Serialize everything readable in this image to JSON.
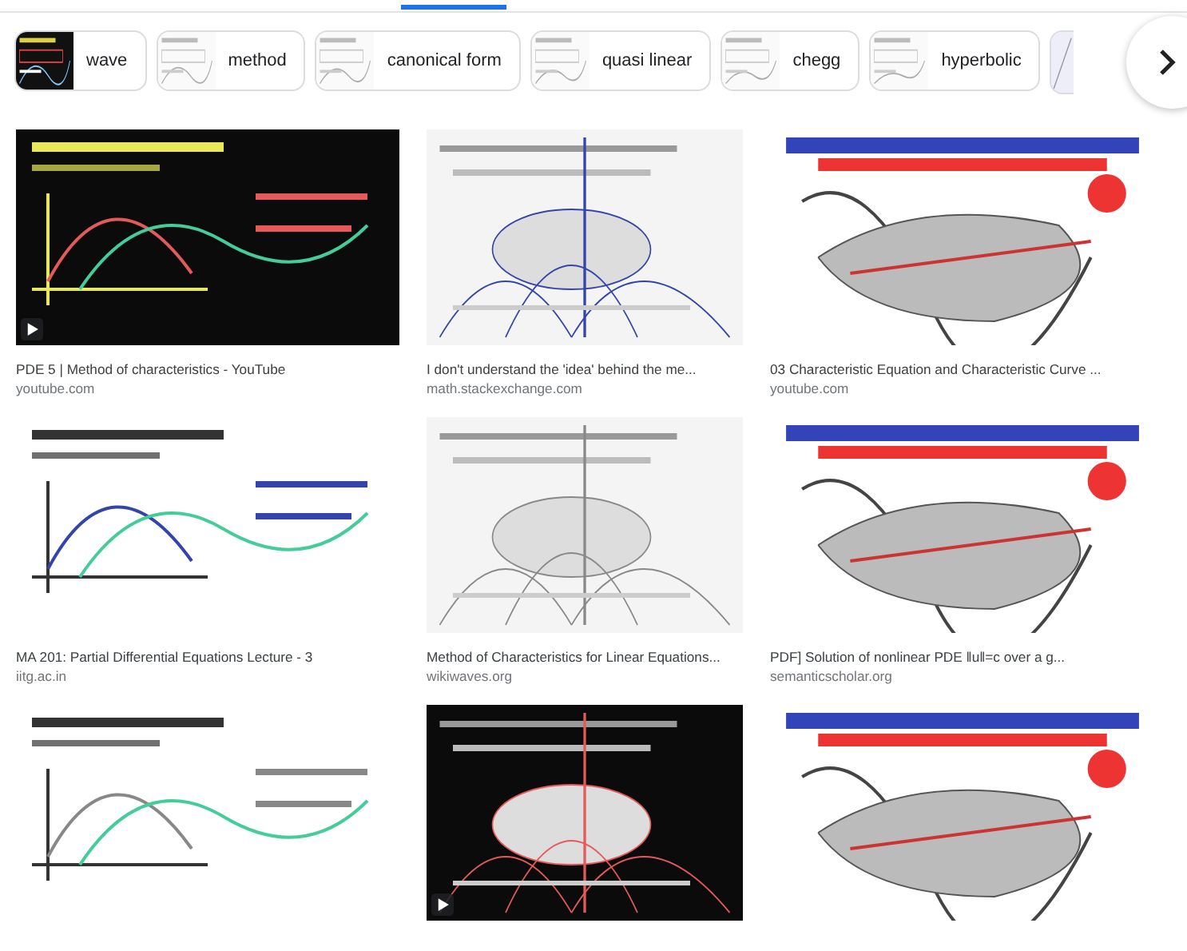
{
  "chips": [
    {
      "label": "wave"
    },
    {
      "label": "method"
    },
    {
      "label": "canonical form"
    },
    {
      "label": "quasi linear"
    },
    {
      "label": "chegg"
    },
    {
      "label": "hyperbolic"
    }
  ],
  "results": [
    {
      "title": "PDE 5 | Method of characteristics - YouTube",
      "source": "youtube.com",
      "video": true
    },
    {
      "title": "I don't understand the 'idea' behind the me...",
      "source": "math.stackexchange.com",
      "video": false
    },
    {
      "title": "03 Characteristic Equation and Characteristic Curve ...",
      "source": "youtube.com",
      "video": false
    },
    {
      "title": "MA 201: Partial Differential Equations Lecture - 3",
      "source": "iitg.ac.in",
      "video": false
    },
    {
      "title": "Method of Characteristics for Linear Equations...",
      "source": "wikiwaves.org",
      "video": false
    },
    {
      "title": "PDF] Solution of nonlinear PDE ‖u‖=c over a g...",
      "source": "semanticscholar.org",
      "video": false
    },
    {
      "video": false
    },
    {
      "video": true
    },
    {
      "video": false
    }
  ]
}
